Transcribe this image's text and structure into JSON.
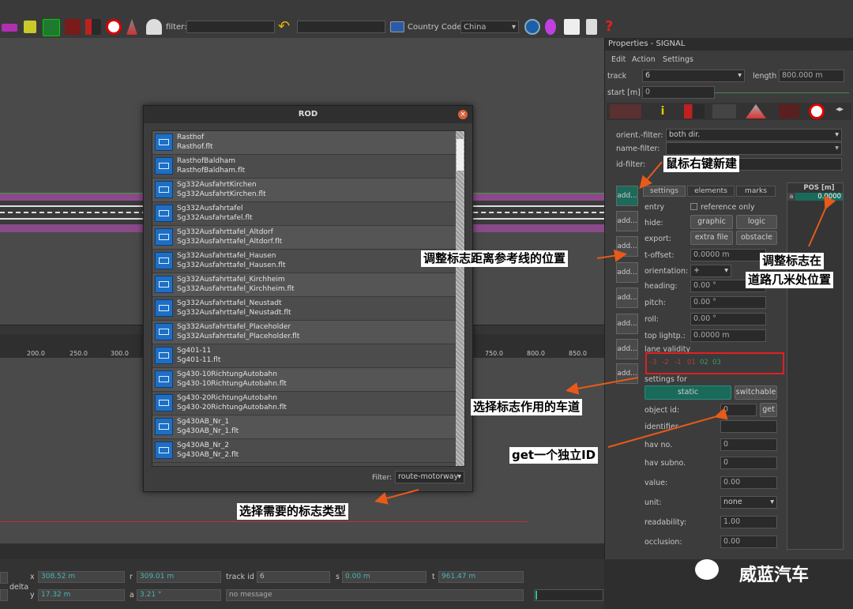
{
  "toolbar": {
    "filter_label": "filter:",
    "country_label": "Country Code:",
    "country_value": "China"
  },
  "viewport": {
    "ruler_ticks": [
      "200.0",
      "250.0",
      "300.0",
      "750.0",
      "800.0",
      "850.0"
    ]
  },
  "properties": {
    "title": "Properties - SIGNAL",
    "menu": [
      "Edit",
      "Action",
      "Settings"
    ],
    "track_label": "track",
    "track_value": "6",
    "length_label": "length",
    "length_value": "800.000 m",
    "start_label": "start [m]",
    "start_value": "0",
    "orient_filter_label": "orient.-filter:",
    "orient_filter_value": "both dir.",
    "name_filter_label": "name-filter:",
    "id_filter_label": "id-filter:",
    "add_label": "add...",
    "subtabs": [
      "settings",
      "elements",
      "marks"
    ],
    "pos_header": "POS [m]",
    "pos_row_label": "a",
    "pos_value": "0.0000",
    "entry_label": "entry",
    "reference_only": "reference only",
    "hide_label": "hide:",
    "graphic_btn": "graphic",
    "logic_btn": "logic",
    "export_label": "export:",
    "extra_file_btn": "extra file",
    "obstacle_btn": "obstacle",
    "t_offset_label": "t-offset:",
    "t_offset_value": "0.0000  m",
    "orientation_label": "orientation:",
    "orientation_value": "+",
    "heading_label": "heading:",
    "heading_value": "0.00 °",
    "pitch_label": "pitch:",
    "pitch_value": "0.00 °",
    "roll_label": "roll:",
    "roll_value": "0.00 °",
    "top_light_label": "top lightp.:",
    "top_light_value": "0.0000  m",
    "lane_validity_label": "lane validity",
    "lane_cells": [
      "-3",
      "-2",
      "-1",
      "01",
      "02",
      "03"
    ],
    "settings_for_label": "settings for",
    "static_btn": "static",
    "switchable_btn": "switchable",
    "object_id_label": "object id:",
    "object_id_value": "0",
    "get_btn": "get",
    "identifier_label": "identifier",
    "hav_no_label": "hav no.",
    "hav_no_value": "0",
    "hav_subno_label": "hav subno.",
    "hav_subno_value": "0",
    "value_label": "value:",
    "value_value": "0.00",
    "unit_label": "unit:",
    "unit_value": "none",
    "readability_label": "readability:",
    "readability_value": "1.00",
    "occlusion_label": "occlusion:",
    "occlusion_value": "0.00"
  },
  "dialog": {
    "title": "ROD",
    "items": [
      {
        "name": "Rasthof",
        "file": "Rasthof.flt"
      },
      {
        "name": "RasthofBaldham",
        "file": "RasthofBaldham.flt"
      },
      {
        "name": "Sg332AusfahrtKirchen",
        "file": "Sg332AusfahrtKirchen.flt"
      },
      {
        "name": "Sg332Ausfahrtafel",
        "file": "Sg332Ausfahrtafel.flt"
      },
      {
        "name": "Sg332Ausfahrttafel_Altdorf",
        "file": "Sg332Ausfahrttafel_Altdorf.flt"
      },
      {
        "name": "Sg332Ausfahrttafel_Hausen",
        "file": "Sg332Ausfahrttafel_Hausen.flt"
      },
      {
        "name": "Sg332Ausfahrttafel_Kirchheim",
        "file": "Sg332Ausfahrttafel_Kirchheim.flt"
      },
      {
        "name": "Sg332Ausfahrttafel_Neustadt",
        "file": "Sg332Ausfahrttafel_Neustadt.flt"
      },
      {
        "name": "Sg332Ausfahrttafel_Placeholder",
        "file": "Sg332Ausfahrttafel_Placeholder.flt"
      },
      {
        "name": "Sg401-11",
        "file": "Sg401-11.flt"
      },
      {
        "name": "Sg430-10RichtungAutobahn",
        "file": "Sg430-10RichtungAutobahn.flt"
      },
      {
        "name": "Sg430-20RichtungAutobahn",
        "file": "Sg430-20RichtungAutobahn.flt"
      },
      {
        "name": "Sg430AB_Nr_1",
        "file": "Sg430AB_Nr_1.flt"
      },
      {
        "name": "Sg430AB_Nr_2",
        "file": "Sg430AB_Nr_2.flt"
      }
    ],
    "filter_label": "Filter:",
    "filter_value": "route-motorway"
  },
  "annotations": {
    "right_click_new": "鼠标右键新建",
    "adjust_ref_line": "调整标志距离参考线的位置",
    "adjust_road_pos_1": "调整标志在",
    "adjust_road_pos_2": "道路几米处位置",
    "select_lane": "选择标志作用的车道",
    "get_id": "get一个独立ID",
    "select_type": "选择需要的标志类型"
  },
  "status": {
    "x_label": "x",
    "x_value": "308.52 m",
    "r_label": "r",
    "r_value": "309.01 m",
    "track_id_label": "track id",
    "track_id_value": "6",
    "s_label": "s",
    "s_value": "0.00 m",
    "t_label": "t",
    "t_value": "961.47 m",
    "delta_label": "delta",
    "y_label": "y",
    "y_value": "17.32 m",
    "a_label": "a",
    "a_value": "3.21 °",
    "message": "no message"
  },
  "watermark": "威蓝汽车"
}
